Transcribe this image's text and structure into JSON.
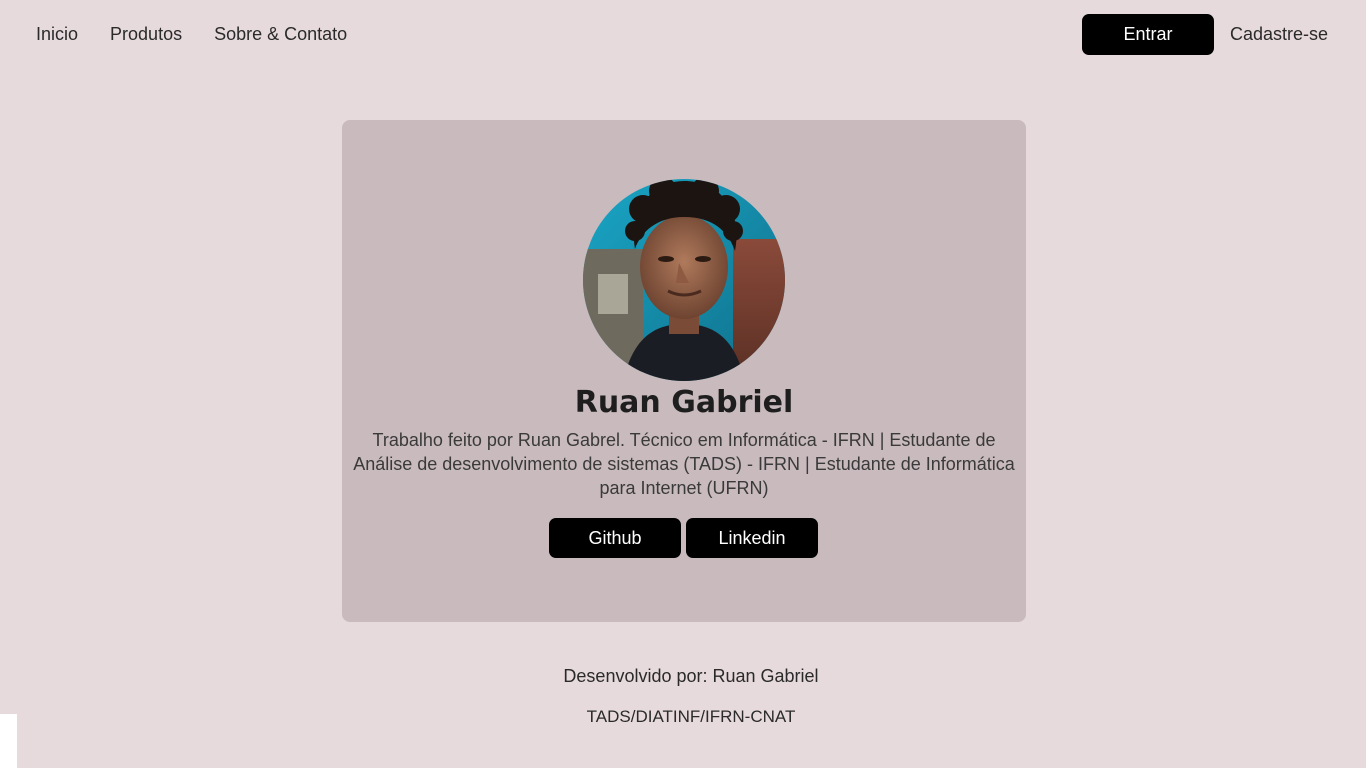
{
  "nav": {
    "links": [
      "Inicio",
      "Produtos",
      "Sobre & Contato"
    ],
    "login_label": "Entrar",
    "signup_label": "Cadastre-se"
  },
  "profile": {
    "name": "Ruan Gabriel",
    "description": "Trabalho feito por Ruan Gabrel. Técnico em Informática - IFRN | Estudante de Análise de desenvolvimento de sistemas (TADS) - IFRN | Estudante de Informática para Internet (UFRN)",
    "links": [
      "Github",
      "Linkedin"
    ]
  },
  "footer": {
    "credit": "Desenvolvido por: Ruan Gabriel",
    "institution": "TADS/DIATINF/IFRN-CNAT"
  },
  "colors": {
    "background": "#e7dadc",
    "card": "#c8babd",
    "button": "#000000"
  }
}
